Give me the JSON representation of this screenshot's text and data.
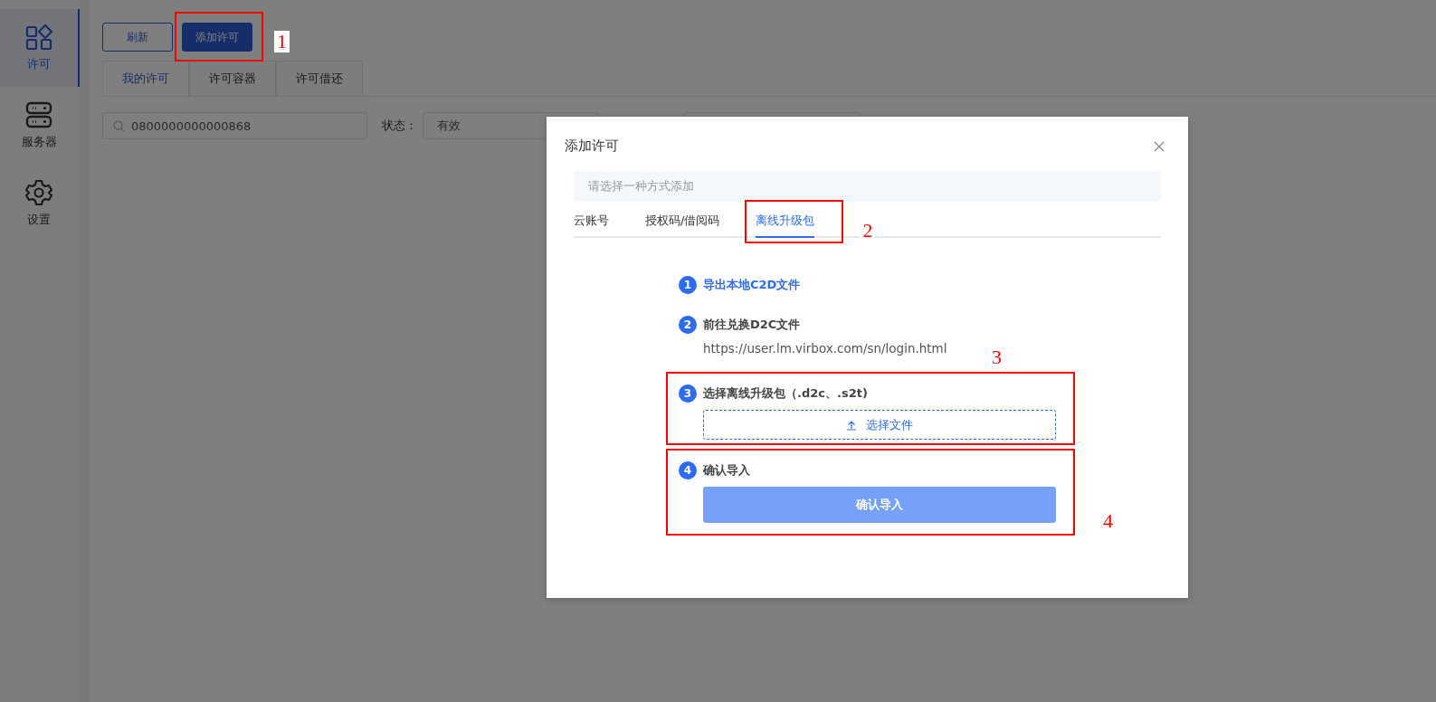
{
  "sidebar": {
    "items": [
      {
        "label": "许可",
        "selected": true
      },
      {
        "label": "服务器",
        "selected": false
      },
      {
        "label": "设置",
        "selected": false
      }
    ]
  },
  "toolbar": {
    "buttons": [
      {
        "label": "刷新",
        "kind": "outline"
      },
      {
        "label": "添加许可",
        "kind": "primary",
        "annotation": {
          "label": "1"
        }
      }
    ]
  },
  "tabs": [
    {
      "label": "我的许可",
      "selected": true
    },
    {
      "label": "许可容器",
      "selected": false
    },
    {
      "label": "许可借还",
      "selected": false
    }
  ],
  "filters": {
    "search": {
      "value": "0800000000000868"
    },
    "status_label": "状态：",
    "status_value": "有效"
  },
  "dialog": {
    "title": "添加许可",
    "hint": "请选择一种方式添加",
    "tabs": [
      {
        "label": "云账号",
        "selected": false
      },
      {
        "label": "授权码/借阅码",
        "selected": false
      },
      {
        "label": "离线升级包",
        "selected": true,
        "annotation": {
          "label": "2"
        }
      }
    ],
    "steps": [
      {
        "number": "1",
        "kind": "link",
        "title": "导出本地C2D文件"
      },
      {
        "number": "2",
        "kind": "text",
        "title": "前往兑换D2C文件",
        "url": "https://user.lm.virbox.com/sn/login.html"
      },
      {
        "number": "3",
        "kind": "upload",
        "title": "选择离线升级包（.d2c、.s2t)",
        "button": "选择文件",
        "annotation": {
          "label": "3"
        }
      },
      {
        "number": "4",
        "kind": "submit",
        "title": "确认导入",
        "button": "确认导入",
        "disabled": true,
        "annotation": {
          "label": "4"
        }
      }
    ]
  }
}
